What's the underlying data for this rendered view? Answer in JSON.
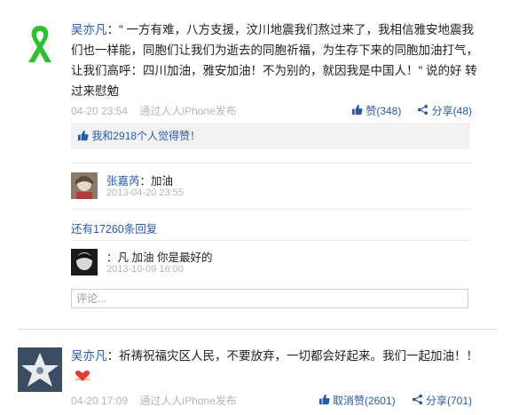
{
  "posts": [
    {
      "author": "吴亦凡",
      "text": "：\" 一方有难，八方支援，汶川地震我们熬过来了，我相信雅安地震我们也一样能，同胞们让我们为逝去的同胞祈福，为生存下来的同胞加油打气，让我们高呼：四川加油，雅安加油！不为别的，就因我是中国人！\" 说的好 转过来慰勉",
      "time": "04-20 23:54",
      "source": "通过人人iPhone发布",
      "like_label": "赞(348)",
      "share_label": "分享(48)",
      "likes_summary": "我和2918个人觉得赞！",
      "comments": [
        {
          "author": "张嘉芮",
          "text": "：加油",
          "time": "2013-04-20 23:55"
        }
      ],
      "more_replies": "还有17260条回复",
      "comments_after": [
        {
          "author": "",
          "text": "：凡 加油 你是最好的",
          "time": "2013-10-09 16:00"
        }
      ],
      "comment_placeholder": "评论..."
    },
    {
      "author": "吴亦凡",
      "text": "：祈祷祝福灾区人民，不要放弃，一切都会好起来。我们一起加油！！",
      "time": "04-20 17:09",
      "source": "通过人人iPhone发布",
      "like_label": "取消赞(2601)",
      "share_label": "分享(701)"
    }
  ],
  "icons": {
    "ribbon": "green-ribbon",
    "like": "thumb-up-icon",
    "share": "share-icon",
    "heart_hands": "heart-hands-emoticon"
  },
  "colors": {
    "link": "#2b5aa5",
    "ribbon": "#2fbf2f",
    "muted": "#b5b5b5"
  }
}
